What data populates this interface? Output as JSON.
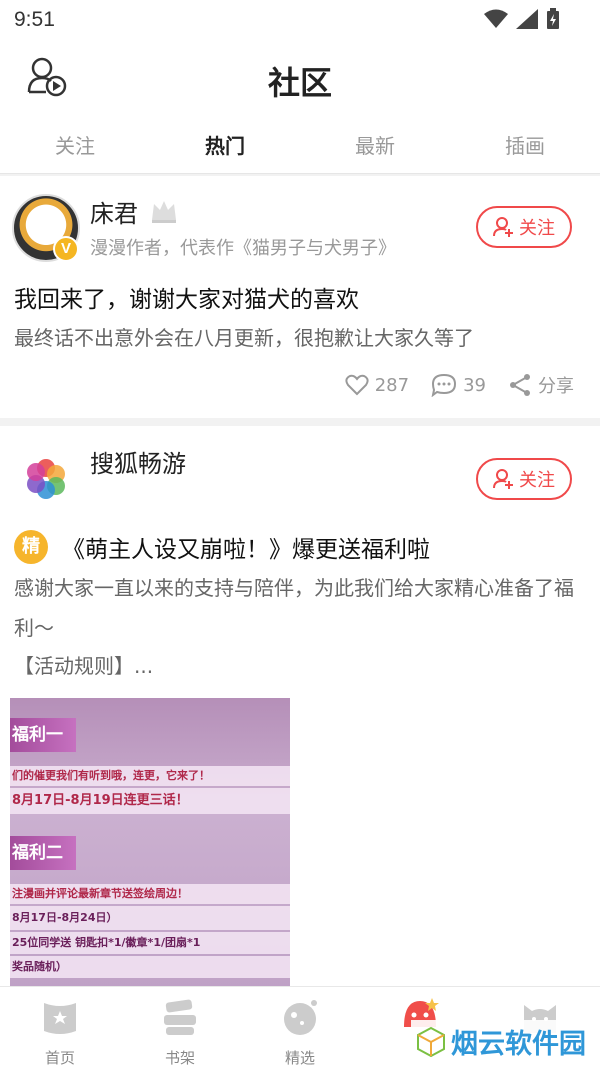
{
  "status_bar": {
    "time": "9:51"
  },
  "header": {
    "title": "社区"
  },
  "tabs": [
    {
      "label": "关注"
    },
    {
      "label": "热门"
    },
    {
      "label": "最新"
    },
    {
      "label": "插画"
    }
  ],
  "posts": [
    {
      "author": "床君",
      "author_badge": "V",
      "subtitle": "漫漫作者，代表作《猫男子与犬男子》",
      "follow_label": "关注",
      "title": "我回来了，谢谢大家对猫犬的喜欢",
      "body": "最终话不出意外会在八月更新，很抱歉让大家久等了",
      "likes": "287",
      "comments": "39",
      "share_label": "分享"
    },
    {
      "author": "搜狐畅游",
      "follow_label": "关注",
      "tag": "精",
      "title": "《萌主人设又崩啦！》爆更送福利啦",
      "body": "感谢大家一直以来的支持与陪伴，为此我们给大家精心准备了福利～",
      "rules": "【活动规则】...",
      "banner": {
        "label1": "福利一",
        "line1": "们的催更我们有听到哦，连更，它来了！",
        "line2": "8月17日-8月19日连更三话！",
        "label2": "福利二",
        "line3": "注漫画并评论最新章节送签绘周边！",
        "line4": "8月17日-8月24日）",
        "line5": "25位同学送 钥匙扣*1/徽章*1/团扇*1",
        "line6": "奖品随机）"
      }
    }
  ],
  "bottom_nav": [
    {
      "label": "首页"
    },
    {
      "label": "书架"
    },
    {
      "label": "精选"
    },
    {
      "label": ""
    },
    {
      "label": ""
    }
  ],
  "watermark": "烟云软件园",
  "colors": {
    "accent": "#f0494a",
    "tag": "#f6b52c",
    "muted": "#999999"
  }
}
